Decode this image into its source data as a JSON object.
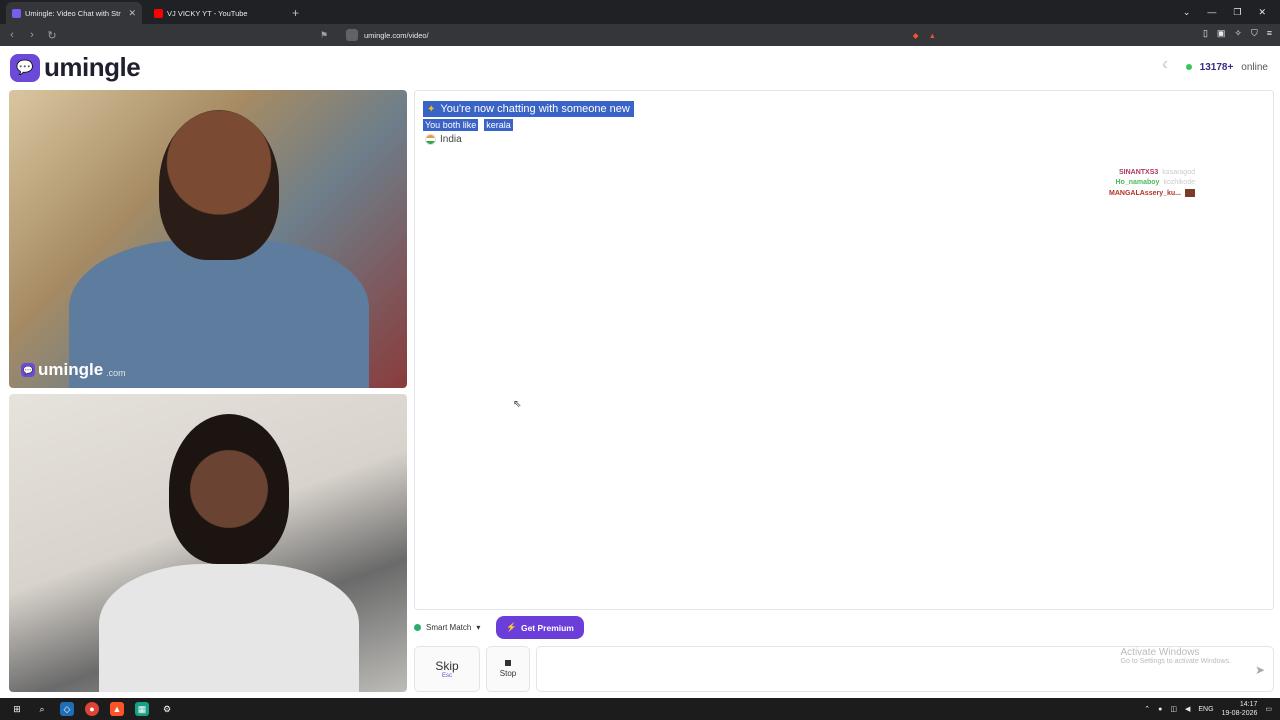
{
  "browser": {
    "tabs": [
      {
        "title": "Umingle: Video Chat with Str",
        "active": true,
        "favicon_color": "#7b5cf0"
      },
      {
        "title": "VJ VICKY YT - YouTube",
        "active": false,
        "favicon_color": "#ff0000"
      }
    ],
    "new_tab": "+",
    "url": "umingle.com/video/"
  },
  "header": {
    "logo_text": "umingle",
    "online_count": "13178+",
    "online_label": "online"
  },
  "remote_video": {
    "watermark_text": "umingle",
    "watermark_tld": ".com"
  },
  "chat": {
    "system_message": "You're now chatting with someone new",
    "shared_interest_label": "You both like",
    "shared_interest": "kerala",
    "country": "India",
    "users": [
      {
        "name": "SINANTXS3",
        "sub": "kasaragod",
        "color": "#b0385a"
      },
      {
        "name": "Ho_namaboy",
        "sub": "kozhikode",
        "color": "#4cbb5d"
      },
      {
        "name": "MANGALAssery_ku...",
        "sub": "",
        "color": "#b23327"
      }
    ]
  },
  "controls": {
    "smart_match": "Smart Match",
    "get_premium": "Get Premium",
    "skip_label": "Skip",
    "skip_sub": "Esc",
    "stop_label": "Stop"
  },
  "watermark_os": {
    "line1": "Activate Windows",
    "line2": "Go to Settings to activate Windows."
  },
  "taskbar": {
    "language": "ENG",
    "time": "14:17",
    "date": "19-08-2026"
  },
  "colors": {
    "brand": "#6c4ad8",
    "premium": "#6b3ed9",
    "selection": "#3a63c7",
    "online": "#34c759"
  }
}
